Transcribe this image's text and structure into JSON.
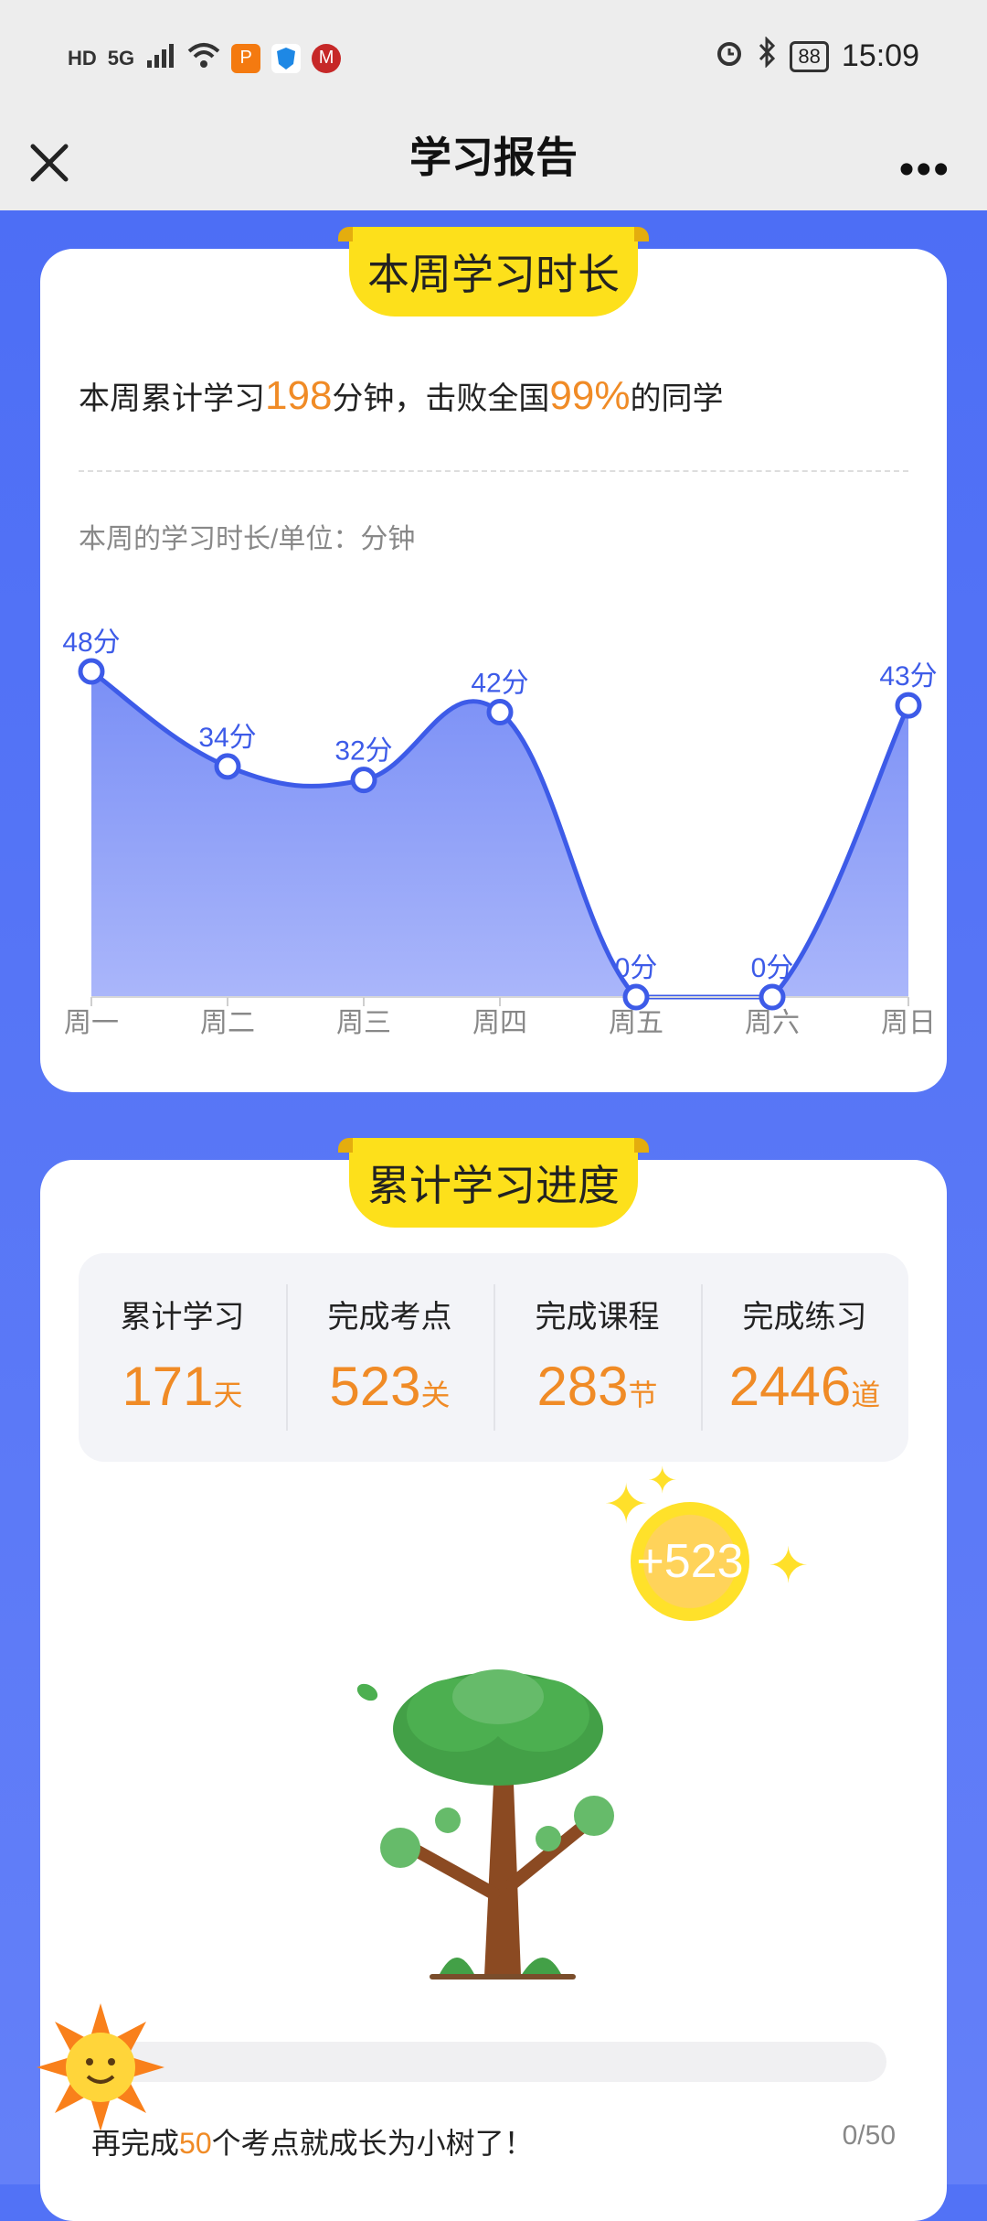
{
  "status_bar": {
    "left_icons": [
      "HD",
      "5G",
      "signal-icon",
      "wifi-icon",
      "app-orange-icon",
      "shield-icon",
      "app-red-icon"
    ],
    "hd": "HD",
    "network": "5G",
    "battery": "88",
    "time": "15:09"
  },
  "nav": {
    "title": "学习报告",
    "more_label": "•••"
  },
  "weekly": {
    "tab_title": "本周学习时长",
    "summary_prefix": "本周累计学习",
    "total_minutes": "198",
    "summary_mid": "分钟，击败全国",
    "beat_percent": "99%",
    "summary_suffix": "的同学",
    "chart_caption": "本周的学习时长/单位：分钟"
  },
  "chart_data": {
    "type": "area",
    "categories": [
      "周一",
      "周二",
      "周三",
      "周四",
      "周五",
      "周六",
      "周日"
    ],
    "values": [
      48,
      34,
      32,
      42,
      0,
      0,
      43
    ],
    "data_labels": [
      "48分",
      "34分",
      "32分",
      "42分",
      "0分",
      "0分",
      "43分"
    ],
    "title": "",
    "xlabel": "",
    "ylabel": "",
    "ylim": [
      0,
      48
    ],
    "colors": {
      "line": "#3d5be8",
      "fill_top": "#7a8ff6",
      "fill_bottom": "#aab6fa"
    }
  },
  "progress": {
    "tab_title": "累计学习进度",
    "stats": [
      {
        "label": "累计学习",
        "value": "171",
        "unit": "天"
      },
      {
        "label": "完成考点",
        "value": "523",
        "unit": "关"
      },
      {
        "label": "完成课程",
        "value": "283",
        "unit": "节"
      },
      {
        "label": "完成练习",
        "value": "2446",
        "unit": "道"
      }
    ],
    "coin_text": "+523",
    "bottom_prefix": "再完成",
    "bottom_count": "50",
    "bottom_suffix": "个考点就成长为小树了！",
    "progress_text": "0/50",
    "progress_fraction": 0
  },
  "colors": {
    "accent_orange": "#f08b26",
    "tab_yellow": "#fde01b",
    "background_blue": "#5272f6"
  }
}
